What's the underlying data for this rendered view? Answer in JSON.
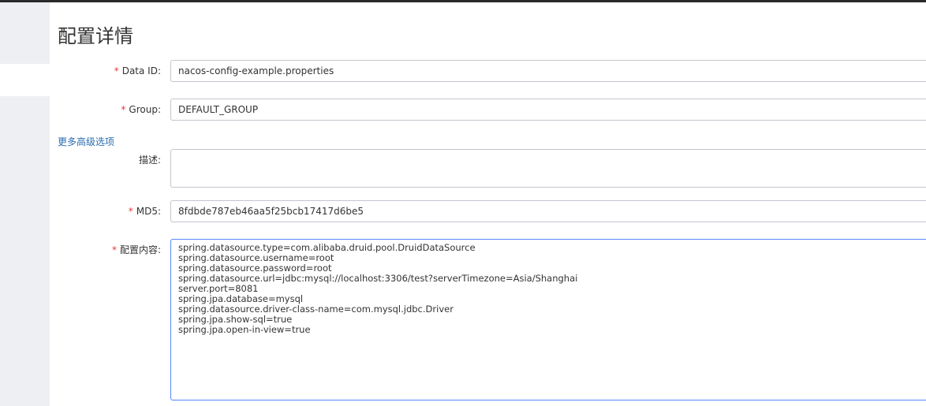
{
  "page": {
    "title": "配置详情"
  },
  "form": {
    "data_id": {
      "label": "Data ID:",
      "required_mark": "*",
      "value": "nacos-config-example.properties"
    },
    "group": {
      "label": "Group:",
      "required_mark": "*",
      "value": "DEFAULT_GROUP"
    },
    "advanced_link": "更多高级选项",
    "description": {
      "label": "描述:",
      "value": ""
    },
    "md5": {
      "label": "MD5:",
      "required_mark": "*",
      "value": "8fdbde787eb46aa5f25bcb17417d6be5"
    },
    "content": {
      "label": "配置内容:",
      "required_mark": "*",
      "lines": [
        "spring.datasource.type=com.alibaba.druid.pool.DruidDataSource",
        "spring.datasource.username=root",
        "spring.datasource.password=root",
        "spring.datasource.url=jdbc:mysql://localhost:3306/test?serverTimezone=Asia/Shanghai",
        "server.port=8081",
        "spring.jpa.database=mysql",
        "spring.datasource.driver-class-name=com.mysql.jdbc.Driver",
        "spring.jpa.show-sql=true",
        "spring.jpa.open-in-view=true"
      ]
    }
  },
  "colors": {
    "required": "#e03c3c",
    "link": "#2a6cb0",
    "focus_border": "#5584ff",
    "border": "#c4c6cf",
    "sidebar": "#eeeff3"
  }
}
